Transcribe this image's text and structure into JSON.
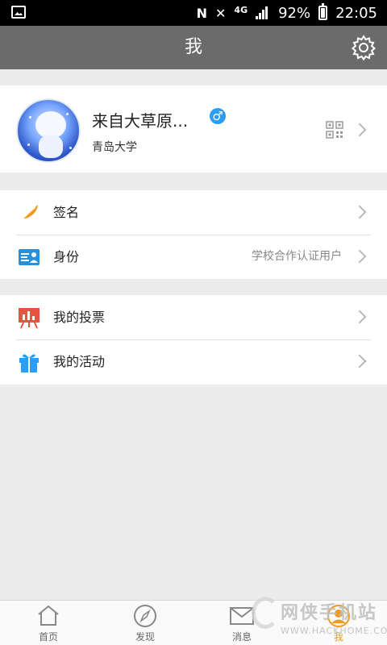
{
  "status_bar": {
    "battery": "92%",
    "time": "22:05",
    "network": "4G",
    "nfc": "N"
  },
  "header": {
    "title": "我"
  },
  "profile": {
    "name": "来自大草原...",
    "gender_symbol": "♂",
    "school": "青岛大学"
  },
  "group1": [
    {
      "label": "签名",
      "value": "",
      "icon": "feather-icon"
    },
    {
      "label": "身份",
      "value": "学校合作认证用户",
      "icon": "id-card-icon"
    }
  ],
  "group2": [
    {
      "label": "我的投票",
      "icon": "vote-chart-icon"
    },
    {
      "label": "我的活动",
      "icon": "gift-icon"
    }
  ],
  "tabs": [
    {
      "label": "首页",
      "icon": "home-icon"
    },
    {
      "label": "发现",
      "icon": "compass-icon"
    },
    {
      "label": "消息",
      "icon": "mail-icon"
    },
    {
      "label": "我",
      "icon": "user-icon",
      "active": true
    }
  ],
  "watermark": {
    "text": "网侠手机站",
    "url": "WWW.HACKHOME.COM"
  },
  "colors": {
    "header_bg": "#6b6b6b",
    "accent_orange": "#f39a1e",
    "gender_blue": "#2a9df4",
    "id_blue": "#2a8fd6",
    "vote_red": "#e5543f",
    "gift_blue": "#2a9df4"
  }
}
